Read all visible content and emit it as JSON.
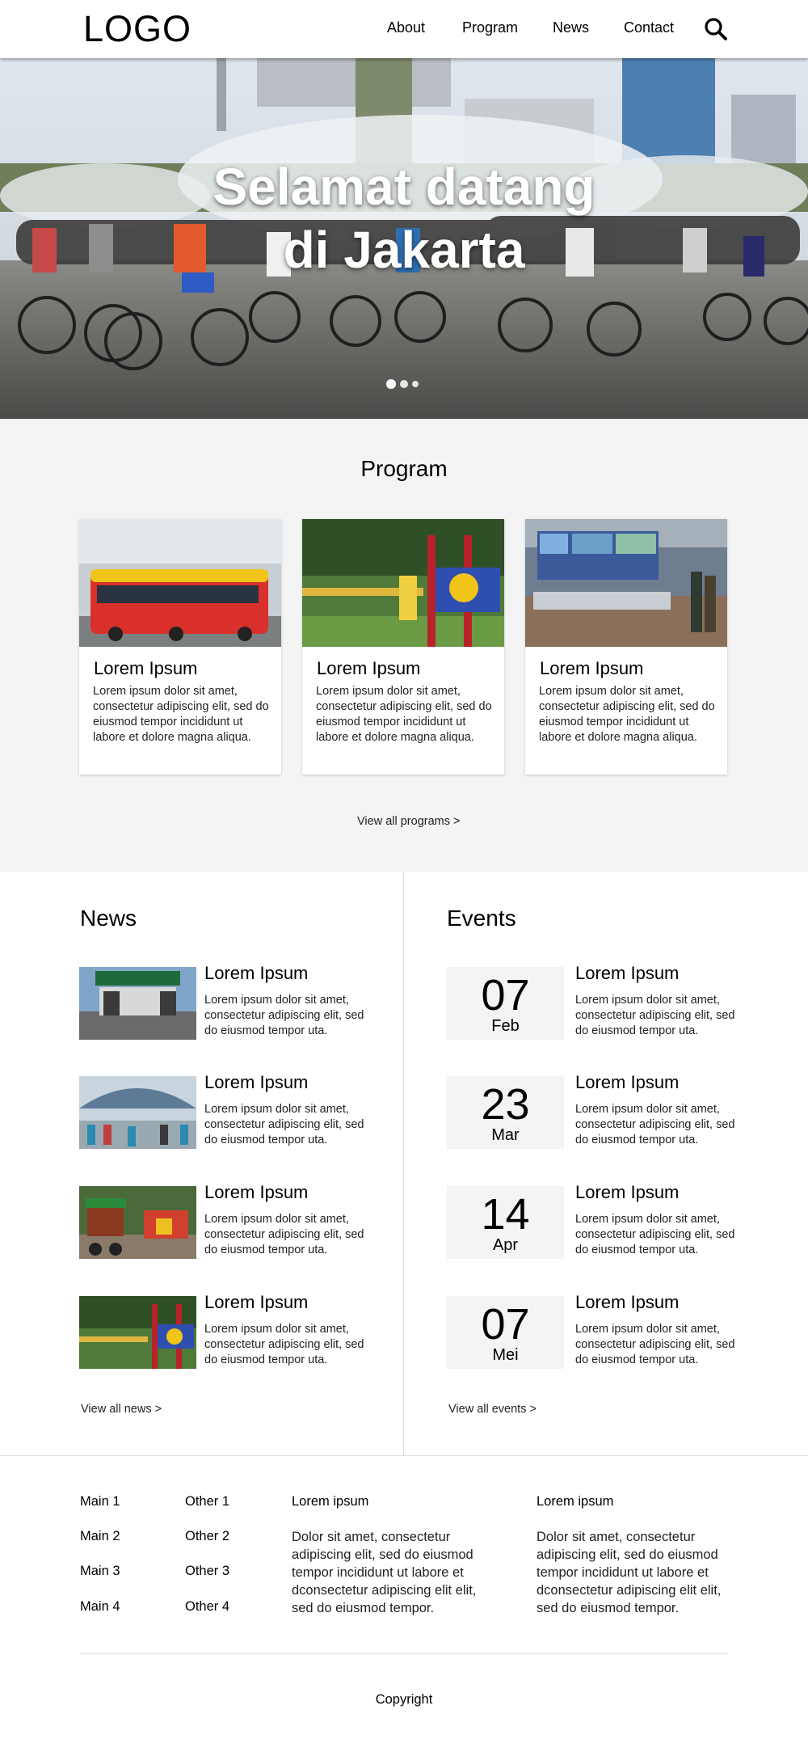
{
  "header": {
    "logo": "LOGO",
    "nav": [
      "About",
      "Program",
      "News",
      "Contact"
    ]
  },
  "hero": {
    "title_line1": "Selamat datang",
    "title_line2": "di Jakarta",
    "slides": 3,
    "active_slide": 1
  },
  "program": {
    "title": "Program",
    "cards": [
      {
        "title": "Lorem Ipsum",
        "text": "Lorem ipsum dolor sit amet, consectetur adipiscing elit, sed do eiusmod tempor incididunt ut labore et dolore magna aliqua."
      },
      {
        "title": "Lorem Ipsum",
        "text": "Lorem ipsum dolor sit amet, consectetur adipiscing elit, sed do eiusmod tempor incididunt ut labore et dolore magna aliqua."
      },
      {
        "title": "Lorem Ipsum",
        "text": "Lorem ipsum dolor sit amet, consectetur adipiscing elit, sed do eiusmod tempor incididunt ut labore et dolore magna aliqua."
      }
    ],
    "view_all": "View all programs  >"
  },
  "news": {
    "title": "News",
    "items": [
      {
        "title": "Lorem Ipsum",
        "text": "Lorem ipsum dolor sit amet, consectetur adipiscing elit, sed do eiusmod tempor uta."
      },
      {
        "title": "Lorem Ipsum",
        "text": "Lorem ipsum dolor sit amet, consectetur adipiscing elit, sed do eiusmod tempor uta."
      },
      {
        "title": "Lorem Ipsum",
        "text": "Lorem ipsum dolor sit amet, consectetur adipiscing elit, sed do eiusmod tempor uta."
      },
      {
        "title": "Lorem Ipsum",
        "text": "Lorem ipsum dolor sit amet, consectetur adipiscing elit, sed do eiusmod tempor uta."
      }
    ],
    "view_all": "View all news  >"
  },
  "events": {
    "title": "Events",
    "items": [
      {
        "day": "07",
        "month": "Feb",
        "title": "Lorem Ipsum",
        "text": "Lorem ipsum dolor sit amet, consectetur adipiscing elit, sed do eiusmod tempor uta."
      },
      {
        "day": "23",
        "month": "Mar",
        "title": "Lorem Ipsum",
        "text": "Lorem ipsum dolor sit amet, consectetur adipiscing elit, sed do eiusmod tempor uta."
      },
      {
        "day": "14",
        "month": "Apr",
        "title": "Lorem Ipsum",
        "text": "Lorem ipsum dolor sit amet, consectetur adipiscing elit, sed do eiusmod tempor uta."
      },
      {
        "day": "07",
        "month": "Mei",
        "title": "Lorem Ipsum",
        "text": "Lorem ipsum dolor sit amet, consectetur adipiscing elit, sed do eiusmod tempor uta."
      }
    ],
    "view_all": "View all events  >"
  },
  "footer": {
    "main_links": [
      "Main 1",
      "Main 2",
      "Main 3",
      "Main 4"
    ],
    "other_links": [
      "Other 1",
      "Other 2",
      "Other 3",
      "Other 4"
    ],
    "col1": {
      "heading": "Lorem ipsum",
      "text": "Dolor sit amet, consectetur adipiscing elit, sed do eiusmod tempor incididunt ut labore et dconsectetur adipiscing elit elit, sed do eiusmod tempor."
    },
    "col2": {
      "heading": "Lorem ipsum",
      "text": "Dolor sit amet, consectetur adipiscing elit, sed do eiusmod tempor incididunt ut labore et dconsectetur adipiscing elit elit, sed do eiusmod tempor."
    },
    "copyright": "Copyright"
  },
  "icons": {
    "search": "search-icon"
  },
  "colors": {
    "section_bg": "#f4f4f4",
    "text": "#111111",
    "bus_red": "#d9302b",
    "card_bg": "#ffffff"
  }
}
